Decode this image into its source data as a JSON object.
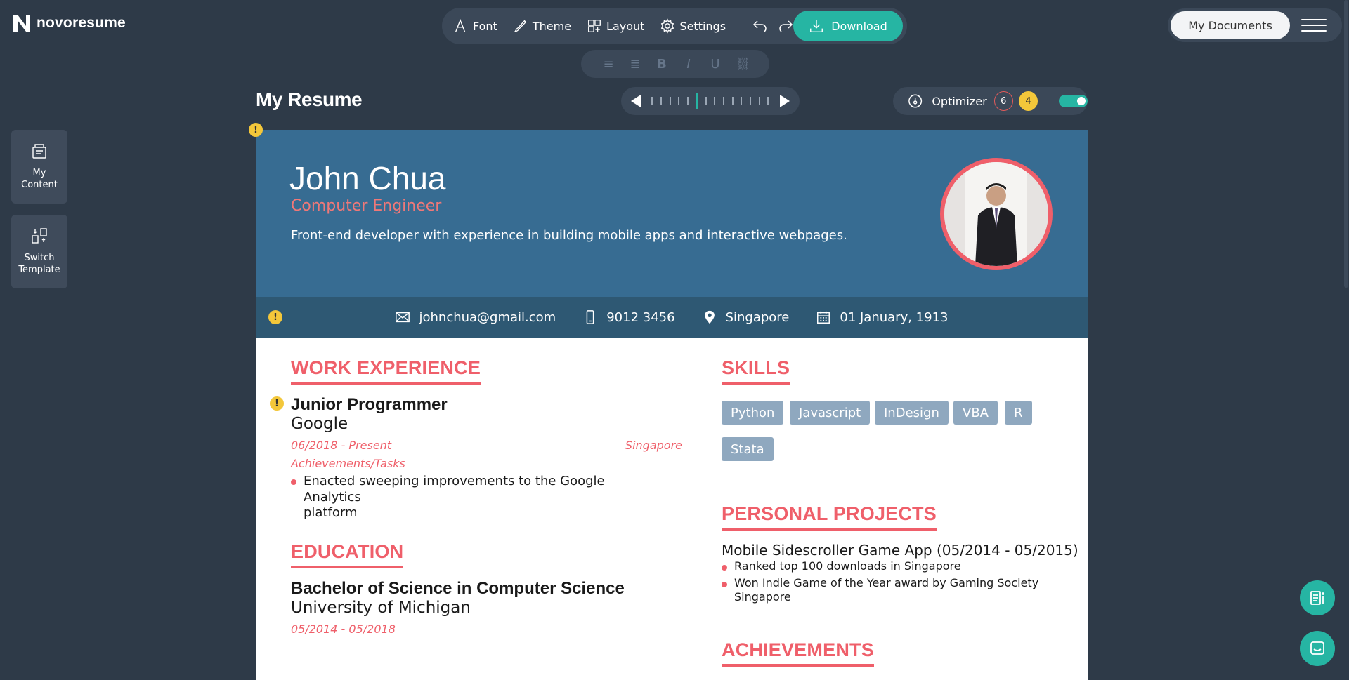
{
  "app": {
    "brand": "novoresume"
  },
  "toolbar": {
    "font": "Font",
    "theme": "Theme",
    "layout": "Layout",
    "settings": "Settings",
    "download": "Download"
  },
  "header_right": {
    "my_documents": "My Documents"
  },
  "page": {
    "title": "My Resume"
  },
  "optimizer": {
    "label": "Optimizer",
    "errors": "6",
    "warnings": "4",
    "enabled": true
  },
  "sidebar": {
    "my_content": "My Content",
    "switch_template": "Switch Template"
  },
  "resume": {
    "name": "John Chua",
    "role": "Computer Engineer",
    "summary": "Front-end developer with experience in building mobile apps and interactive webpages.",
    "contact": {
      "email": "johnchua@gmail.com",
      "phone": "9012 3456",
      "location": "Singapore",
      "dob": "01 January, 1913"
    },
    "work": {
      "heading": "WORK EXPERIENCE",
      "title": "Junior Programmer",
      "company": "Google",
      "dates": "06/2018 - Present",
      "location": "Singapore",
      "tasks_label": "Achievements/Tasks",
      "bullet_line1": "Enacted sweeping improvements to the Google Analytics",
      "bullet_line2": "platform"
    },
    "education": {
      "heading": "EDUCATION",
      "degree": "Bachelor of Science in Computer Science",
      "school": "University of Michigan",
      "dates": "05/2014 - 05/2018"
    },
    "skills": {
      "heading": "SKILLS",
      "items": [
        "Python",
        "Javascript",
        "InDesign",
        "VBA",
        "R",
        "Stata"
      ]
    },
    "projects": {
      "heading": "PERSONAL PROJECTS",
      "title": "Mobile Sidescroller Game App (05/2014 - 05/2015)",
      "bullet1": "Ranked top 100 downloads in Singapore",
      "bullet2_line1": "Won Indie Game of the Year award by Gaming Society",
      "bullet2_line2": "Singapore"
    },
    "achievements": {
      "heading": "ACHIEVEMENTS"
    }
  },
  "colors": {
    "background": "#2e3a48",
    "accent": "#26b5a3",
    "resume_header": "#376c92",
    "resume_contact_bar": "#2e5873",
    "resume_accent": "#ef5f6a",
    "warning": "#f3c73a"
  }
}
